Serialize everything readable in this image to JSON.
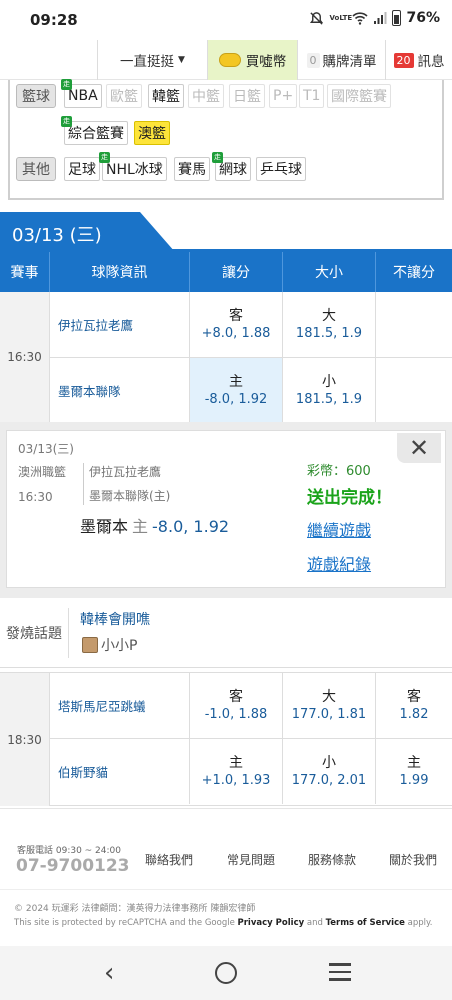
{
  "status": {
    "time": "09:28",
    "icons": [
      "mute-icon",
      "volte-icon",
      "wifi-icon",
      "signal-icon",
      "battery-icon"
    ],
    "volte": "VoLTE",
    "battery": "76%"
  },
  "nav": {
    "stay": "一直挺挺",
    "coin": "買噓幣",
    "cart_count": "0",
    "cart": "購牌清單",
    "msg_count": "20",
    "msg": "訊息"
  },
  "categories": {
    "basketball_label": "籃球",
    "basketball": [
      {
        "label": "NBA",
        "live": true,
        "state": "on"
      },
      {
        "label": "歐籃",
        "live": false,
        "state": "off"
      },
      {
        "label": "韓籃",
        "live": false,
        "state": "on"
      },
      {
        "label": "中籃",
        "live": false,
        "state": "off"
      },
      {
        "label": "日籃",
        "live": false,
        "state": "off"
      },
      {
        "label": "P+",
        "live": false,
        "state": "off"
      },
      {
        "label": "T1",
        "live": false,
        "state": "off"
      },
      {
        "label": "國際籃賽",
        "live": false,
        "state": "off"
      },
      {
        "label": "綜合籃賽",
        "live": true,
        "state": "on"
      },
      {
        "label": "澳籃",
        "live": false,
        "state": "selected"
      }
    ],
    "other_label": "其他",
    "other": [
      {
        "label": "足球",
        "live": false
      },
      {
        "label": "NHL冰球",
        "live": true
      },
      {
        "label": "賽馬",
        "live": false
      },
      {
        "label": "網球",
        "live": true
      },
      {
        "label": "乒乓球",
        "live": false
      }
    ],
    "live_mark": "走"
  },
  "date_label": "03/13 (三)",
  "table_headers": [
    "賽事",
    "球隊資訊",
    "讓分",
    "大小",
    "不讓分"
  ],
  "games": [
    {
      "time": "16:30",
      "rows": [
        {
          "team": "伊拉瓦拉老鷹",
          "spread_side": "客",
          "spread": "+8.0, 1.88",
          "ou_side": "大",
          "ou": "181.5, 1.9",
          "ml_side": "",
          "ml": ""
        },
        {
          "team": "墨爾本聯隊",
          "spread_side": "主",
          "spread": "-8.0, 1.92",
          "ou_side": "小",
          "ou": "181.5, 1.9",
          "ml_side": "",
          "ml": ""
        }
      ]
    },
    {
      "time": "18:30",
      "rows": [
        {
          "team": "塔斯馬尼亞跳蟻",
          "spread_side": "客",
          "spread": "-1.0, 1.88",
          "ou_side": "大",
          "ou": "177.0, 1.81",
          "ml_side": "客",
          "ml": "1.82"
        },
        {
          "team": "伯斯野貓",
          "spread_side": "主",
          "spread": "+1.0, 1.93",
          "ou_side": "小",
          "ou": "177.0, 2.01",
          "ml_side": "主",
          "ml": "1.99"
        }
      ]
    }
  ],
  "popup": {
    "date": "03/13(三)",
    "league": "澳洲職籃",
    "time": "16:30",
    "away": "伊拉瓦拉老鷹",
    "home": "墨爾本聯隊(主)",
    "pick_team": "墨爾本",
    "pick_side": "主",
    "pick_odds": "-8.0, 1.92",
    "coins": "彩幣：600",
    "done": "送出完成！",
    "continue": "繼續遊戲",
    "records": "遊戲紀錄",
    "close": "✕"
  },
  "hot": {
    "label": "發燒話題",
    "title": "韓棒會開噍",
    "user": "小小P"
  },
  "footer": {
    "service_label": "客服電話 09:30 ~ 24:00",
    "phone": "07-9700123",
    "links": [
      "聯絡我們",
      "常見問題",
      "服務條款",
      "關於我們"
    ],
    "copyright": "© 2024 玩運彩  法律顧問：漢英得力法律事務所 陳韻宏律師",
    "captcha_pre": "This site is protected by reCAPTCHA and the Google ",
    "privacy": "Privacy Policy",
    "and": " and ",
    "terms": "Terms of Service",
    "apply": " apply."
  },
  "sysnav": {
    "back": "‹"
  }
}
